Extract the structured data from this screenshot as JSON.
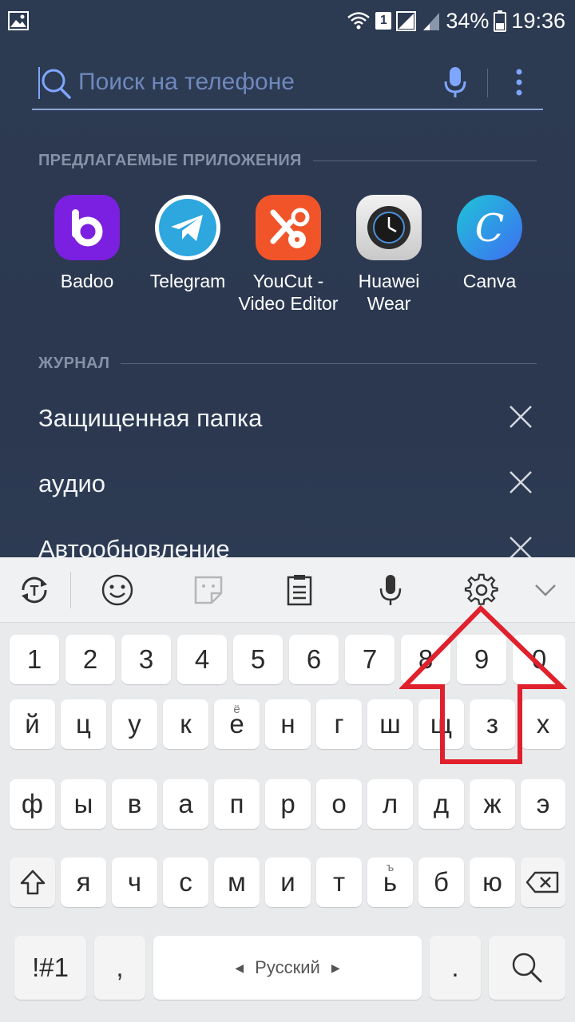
{
  "status_bar": {
    "sim_label": "1",
    "battery": "34%",
    "time": "19:36",
    "icons": [
      "gallery-icon",
      "wifi-icon",
      "signal-icon",
      "signal-weak-icon",
      "battery-icon"
    ]
  },
  "search": {
    "placeholder": "Поиск на телефоне"
  },
  "suggested": {
    "header": "ПРЕДЛАГАЕМЫЕ ПРИЛОЖЕНИЯ",
    "apps": [
      {
        "label": "Badoo",
        "color": "#7b1fe0"
      },
      {
        "label": "Telegram",
        "color": "#2ea6de"
      },
      {
        "label": "YouCut -\nVideo Editor",
        "label_line1": "YouCut -",
        "label_line2": "Video Editor",
        "color": "#f2542a"
      },
      {
        "label": "Huawei Wear",
        "label_line1": "Huawei",
        "label_line2": "Wear",
        "color": "#d8d8d8"
      },
      {
        "label": "Canva",
        "color": "#2c8ce8"
      }
    ]
  },
  "history": {
    "header": "ЖУРНАЛ",
    "items": [
      "Защищенная папка",
      "аудио",
      "Автообновление"
    ]
  },
  "keyboard": {
    "toolbar": [
      "translate-icon",
      "emoji-icon",
      "sticker-icon",
      "clipboard-icon",
      "mic-icon",
      "settings-gear-icon",
      "collapse-icon"
    ],
    "row_numbers": [
      "1",
      "2",
      "3",
      "4",
      "5",
      "6",
      "7",
      "8",
      "9",
      "0"
    ],
    "row1": [
      "й",
      "ц",
      "у",
      "к",
      "е",
      "н",
      "г",
      "ш",
      "щ",
      "з",
      "х"
    ],
    "row1_alt_e": "ё",
    "row2": [
      "ф",
      "ы",
      "в",
      "а",
      "п",
      "р",
      "о",
      "л",
      "д",
      "ж",
      "э"
    ],
    "row3": [
      "я",
      "ч",
      "с",
      "м",
      "и",
      "т",
      "ь",
      "б",
      "ю"
    ],
    "row3_alt_soft": "ъ",
    "symbols_label": "!#1",
    "comma": ",",
    "space_label": "Русский",
    "period": ".",
    "accent_color": "#e0202c"
  }
}
